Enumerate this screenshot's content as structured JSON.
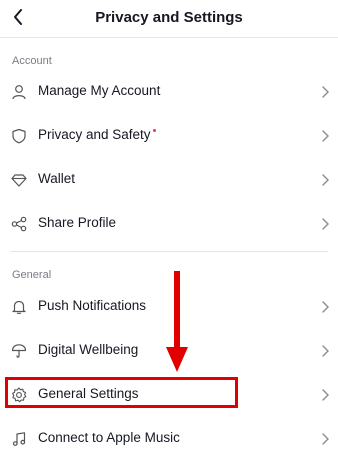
{
  "header": {
    "title": "Privacy and Settings",
    "back_icon": "chevron-left-icon"
  },
  "sections": [
    {
      "label": "Account",
      "items": [
        {
          "label": "Manage My Account",
          "icon": "person-icon"
        },
        {
          "label": "Privacy and Safety",
          "icon": "shield-icon",
          "badge": "notification-dot"
        },
        {
          "label": "Wallet",
          "icon": "diamond-icon"
        },
        {
          "label": "Share Profile",
          "icon": "share-icon"
        }
      ]
    },
    {
      "label": "General",
      "items": [
        {
          "label": "Push Notifications",
          "icon": "bell-icon"
        },
        {
          "label": "Digital Wellbeing",
          "icon": "umbrella-icon"
        },
        {
          "label": "General Settings",
          "icon": "gear-icon",
          "highlighted": true
        },
        {
          "label": "Connect to Apple Music",
          "icon": "music-note-icon"
        }
      ]
    }
  ],
  "colors": {
    "text": "#161823",
    "secondary_text": "#7b7d85",
    "divider": "#e6e6e8",
    "badge_dot": "#fe2c55",
    "annotation": "#e00000"
  }
}
